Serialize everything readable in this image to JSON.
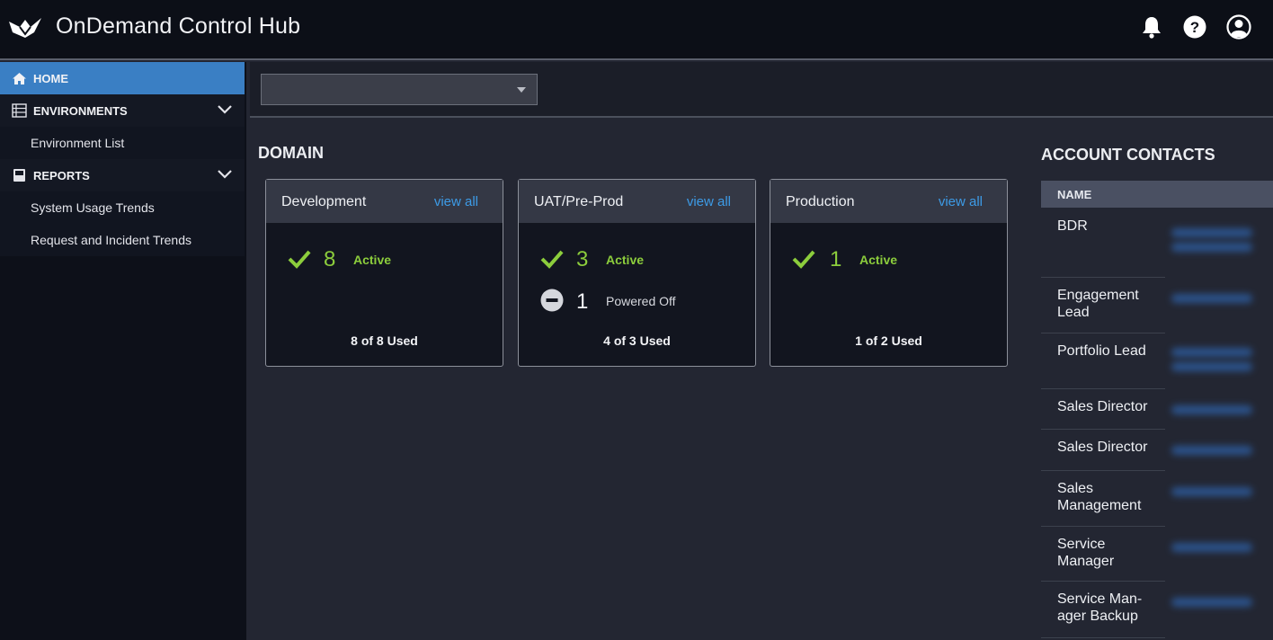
{
  "app": {
    "title": "OnDemand Control Hub"
  },
  "header_icons": [
    "bell-icon",
    "help-icon",
    "user-account-icon"
  ],
  "sidebar": {
    "home": "HOME",
    "environments": "ENVIRONMENTS",
    "environment_list": "Environment List",
    "reports": "REPORTS",
    "system_usage_trends": "System Usage Trends",
    "request_incident_trends": "Request and Incident Trends"
  },
  "toolbar": {
    "selector_value": ""
  },
  "domain": {
    "title": "DOMAIN",
    "cards": [
      {
        "name": "Development",
        "link": "view all",
        "active_count": "8",
        "active_label": "Active",
        "used": "8 of 8 Used"
      },
      {
        "name": "UAT/Pre-Prod",
        "link": "view all",
        "active_count": "3",
        "active_label": "Active",
        "off_count": "1",
        "off_label": "Powered Off",
        "used": "4 of 3 Used"
      },
      {
        "name": "Production",
        "link": "view all",
        "active_count": "1",
        "active_label": "Active",
        "used": "1 of 2 Used"
      }
    ]
  },
  "contacts": {
    "title": "ACCOUNT CONTACTS",
    "column": "NAME",
    "roles": [
      "BDR",
      "Engagement Lead",
      "Portfolio Lead",
      "Sales Director",
      "Sales Director",
      "Sales Management",
      "Service Manager",
      "Service Man-ager Backup"
    ]
  },
  "colors": {
    "accent": "#3a7fc4",
    "active": "#8ccd3c",
    "link": "#3d9be6"
  }
}
